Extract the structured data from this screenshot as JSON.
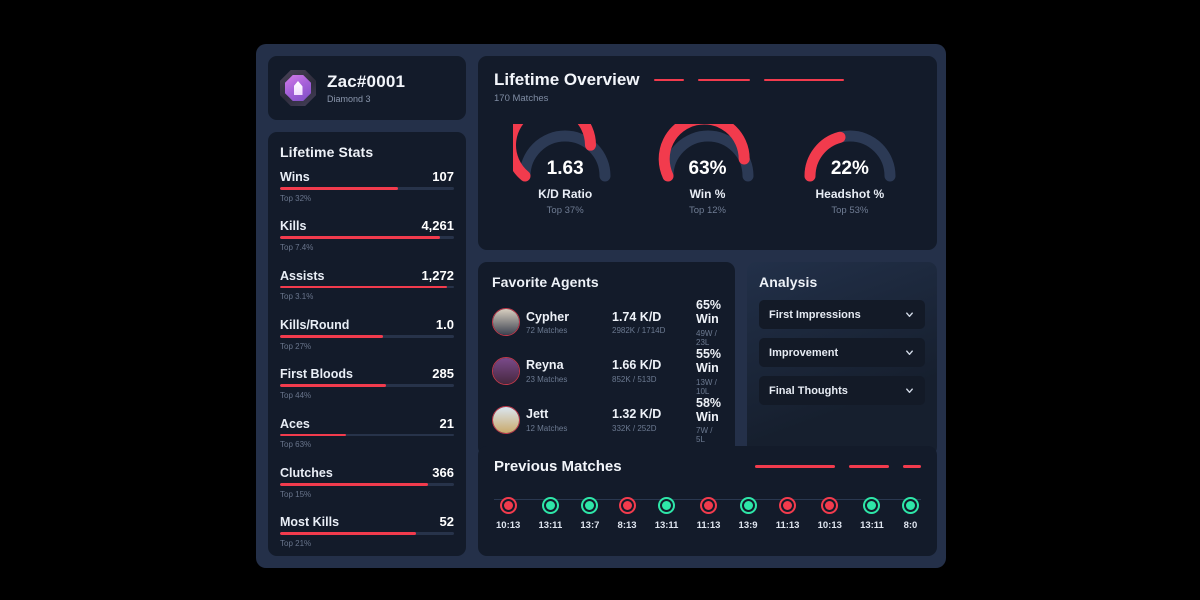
{
  "theme": {
    "accent_red": "#f23b4d",
    "win_green": "#2ee6a8",
    "card_bg": "#131b2a",
    "app_bg": "#243049"
  },
  "profile": {
    "name": "Zac#0001",
    "rank": "Diamond 3",
    "badge_icon": "rank-badge-icon"
  },
  "lifetime_stats": {
    "title": "Lifetime Stats",
    "items": [
      {
        "label": "Wins",
        "value": "107",
        "top": "Top 32%",
        "fill": 68
      },
      {
        "label": "Kills",
        "value": "4,261",
        "top": "Top 7.4%",
        "fill": 92
      },
      {
        "label": "Assists",
        "value": "1,272",
        "top": "Top 3.1%",
        "fill": 96
      },
      {
        "label": "Kills/Round",
        "value": "1.0",
        "top": "Top 27%",
        "fill": 59
      },
      {
        "label": "First Bloods",
        "value": "285",
        "top": "Top 44%",
        "fill": 61
      },
      {
        "label": "Aces",
        "value": "21",
        "top": "Top 63%",
        "fill": 38
      },
      {
        "label": "Clutches",
        "value": "366",
        "top": "Top 15%",
        "fill": 85
      },
      {
        "label": "Most Kills",
        "value": "52",
        "top": "Top 21%",
        "fill": 78
      }
    ]
  },
  "overview": {
    "title": "Lifetime Overview",
    "subtitle": "170 Matches",
    "dashes": [
      30,
      52,
      80
    ],
    "gauges": [
      {
        "value": "1.63",
        "label": "K/D Ratio",
        "top": "Top 37%",
        "pct": 72
      },
      {
        "value": "63%",
        "label": "Win %",
        "top": "Top 12%",
        "pct": 86
      },
      {
        "value": "22%",
        "label": "Headshot %",
        "top": "Top 53%",
        "pct": 42
      }
    ]
  },
  "favorite_agents": {
    "title": "Favorite Agents",
    "rows": [
      {
        "name": "Cypher",
        "matches": "72 Matches",
        "kd": "1.74 K/D",
        "kd_sub": "2982K / 1714D",
        "win": "65% Win",
        "win_sub": "49W / 23L",
        "face_top": "#d8cfc0",
        "face_bottom": "#3c4250"
      },
      {
        "name": "Reyna",
        "matches": "23 Matches",
        "kd": "1.66 K/D",
        "kd_sub": "852K / 513D",
        "win": "55% Win",
        "win_sub": "13W / 10L",
        "face_top": "#7a4a8a",
        "face_bottom": "#46283f"
      },
      {
        "name": "Jett",
        "matches": "12 Matches",
        "kd": "1.32 K/D",
        "kd_sub": "332K / 252D",
        "win": "58% Win",
        "win_sub": "7W / 5L",
        "face_top": "#dbe6f0",
        "face_bottom": "#c9a96b"
      }
    ]
  },
  "analysis": {
    "title": "Analysis",
    "items": [
      {
        "label": "First Impressions",
        "icon": "chevron-down-icon"
      },
      {
        "label": "Improvement",
        "icon": "chevron-down-icon"
      },
      {
        "label": "Final Thoughts",
        "icon": "chevron-down-icon"
      }
    ]
  },
  "previous_matches": {
    "title": "Previous Matches",
    "dashes": [
      80,
      40,
      18
    ],
    "matches": [
      {
        "score": "10:13",
        "result": "loss"
      },
      {
        "score": "13:11",
        "result": "win"
      },
      {
        "score": "13:7",
        "result": "win"
      },
      {
        "score": "8:13",
        "result": "loss"
      },
      {
        "score": "13:11",
        "result": "win"
      },
      {
        "score": "11:13",
        "result": "loss"
      },
      {
        "score": "13:9",
        "result": "win"
      },
      {
        "score": "11:13",
        "result": "loss"
      },
      {
        "score": "10:13",
        "result": "loss"
      },
      {
        "score": "13:11",
        "result": "win"
      },
      {
        "score": "8:0",
        "result": "win"
      }
    ]
  }
}
